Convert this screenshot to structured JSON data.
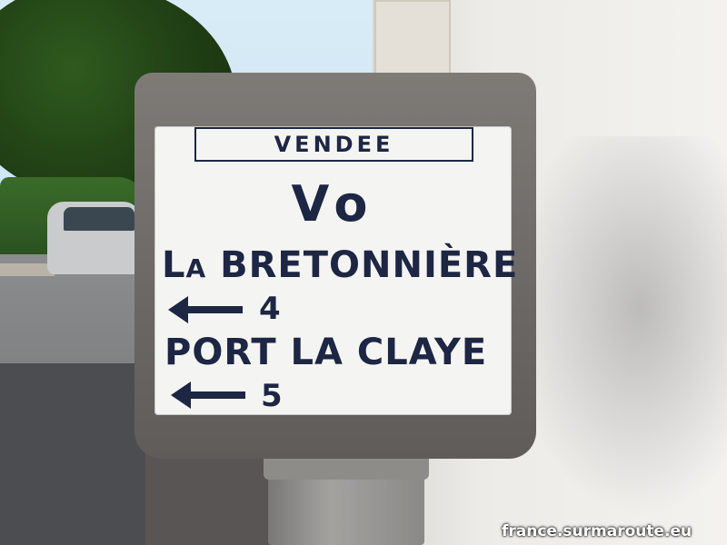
{
  "sign": {
    "department": "VENDEE",
    "route": "Vo",
    "destinations": [
      {
        "prefix": "L",
        "prefix_small": "A",
        "name": " BRETONNIÈRE",
        "distance": "4",
        "arrow": "left-arrow-icon"
      },
      {
        "name": "PORT LA CLAYE",
        "distance": "5",
        "arrow": "left-arrow-icon"
      }
    ],
    "colors": {
      "text": "#1d2643",
      "plate": "#f4f5f2",
      "stone": "#6a6764"
    }
  },
  "watermark": "france.surmaroute.eu"
}
